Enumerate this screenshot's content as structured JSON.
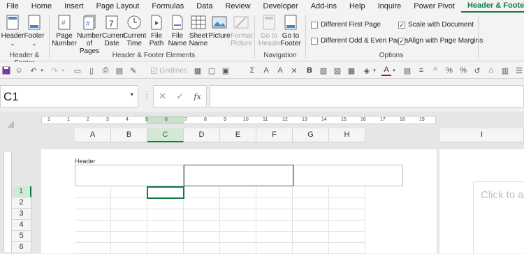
{
  "tabs": [
    "File",
    "Home",
    "Insert",
    "Page Layout",
    "Formulas",
    "Data",
    "Review",
    "Developer",
    "Add-ins",
    "Help",
    "Inquire",
    "Power Pivot",
    "Header & Footer"
  ],
  "ribbon": {
    "header": "Header",
    "footer": "Footer",
    "page_number": "Page Number",
    "number_of_pages": "Number of Pages",
    "current_date": "Current Date",
    "current_time": "Current Time",
    "file_path": "File Path",
    "file_name": "File Name",
    "sheet_name": "Sheet Name",
    "picture": "Picture",
    "format_picture": "Format Picture",
    "go_to_header": "Go to Header",
    "go_to_footer": "Go to Footer",
    "group_hf": "Header & Footer",
    "group_elements": "Header & Footer Elements",
    "group_navigation": "Navigation",
    "group_options": "Options",
    "opt_diff_first": "Different First Page",
    "opt_diff_oddeven": "Different Odd & Even Pages",
    "opt_scale": "Scale with Document",
    "opt_align": "Align with Page Margins",
    "opt_diff_first_checked": false,
    "opt_diff_oddeven_checked": false,
    "opt_scale_checked": true,
    "opt_align_checked": true
  },
  "qat": {
    "gridlines": "Gridlines",
    "check_symbol": "✓"
  },
  "formula_bar": {
    "name_box": "C1",
    "fx": "fx",
    "cancel": "✕",
    "enter": "✓",
    "formula": ""
  },
  "sheet": {
    "columns": [
      "A",
      "B",
      "C",
      "D",
      "E",
      "F",
      "G",
      "H",
      "I"
    ],
    "selected_column": "C",
    "rows": [
      "1",
      "2",
      "3",
      "4",
      "5",
      "6"
    ],
    "selected_row": "1",
    "ruler_numbers": [
      "1",
      "1",
      "2",
      "3",
      "4",
      "5",
      "6",
      "7",
      "8",
      "9",
      "10",
      "11",
      "12",
      "13",
      "14",
      "15",
      "16",
      "17",
      "18",
      "19"
    ],
    "header_label": "Header",
    "click_to_add": "Click to ac",
    "accent_color": "#107c41"
  }
}
